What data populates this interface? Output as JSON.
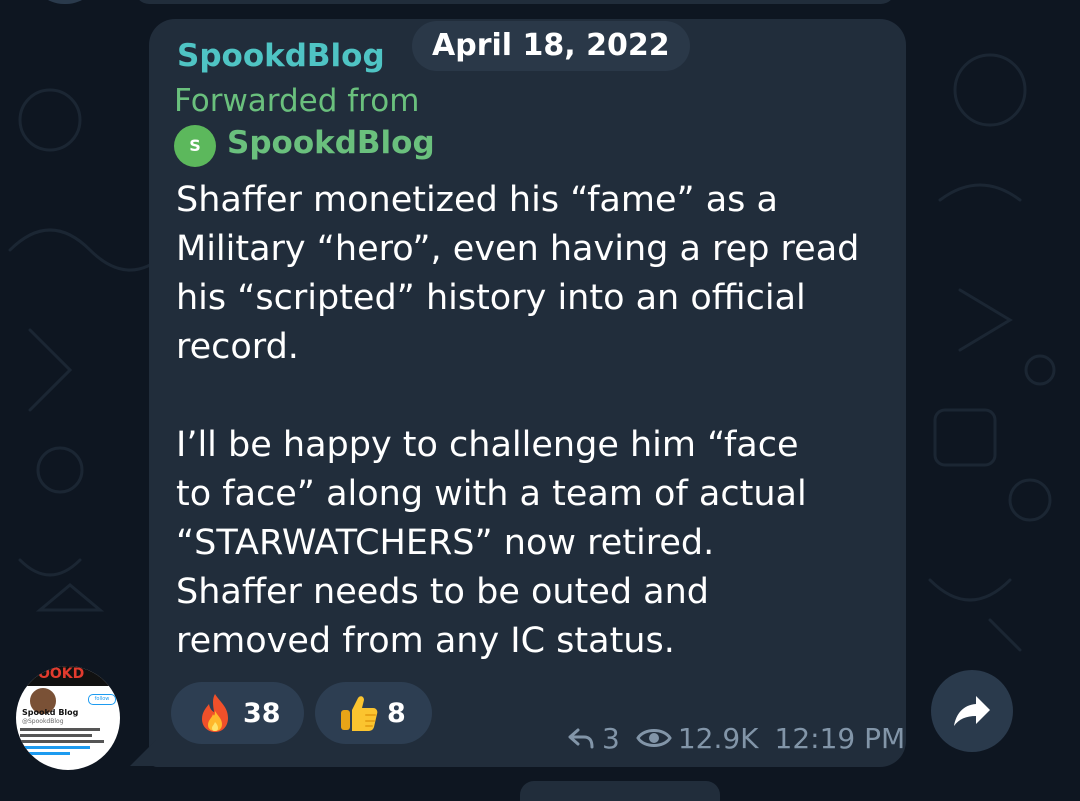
{
  "chat": {
    "sender_name": "SpookdBlog",
    "date": "April 18, 2022",
    "forwarded_label": "Forwarded from",
    "forwarded_avatar_letter": "S",
    "forwarded_from": "SpookdBlog",
    "message_lines": [
      "Shaffer monetized his “fame” as a",
      "Military “hero”, even having a rep read",
      "his “scripted” history into an official",
      "record.",
      "I’ll be happy to challenge him “face",
      "to face” along with a team of actual",
      "“STARWATCHERS” now retired.",
      "Shaffer needs to be outed and",
      "removed from any IC status."
    ],
    "reactions": [
      {
        "icon": "fire-icon",
        "count": "38"
      },
      {
        "icon": "thumbs-up-icon",
        "count": "8"
      }
    ],
    "replies": "3",
    "views": "12.9K",
    "time": "12:19 PM"
  },
  "avatar": {
    "banner_text": "OOKD",
    "name": "Spookd Blog",
    "handle": "@SpookdBlog",
    "follow_label": "follow"
  },
  "colors": {
    "background": "#0e1621",
    "bubble": "#212d3b",
    "sender": "#4fc4c4",
    "forward": "#6ac07d",
    "meta": "#8295a8",
    "reaction_pill": "#2d3e52"
  }
}
